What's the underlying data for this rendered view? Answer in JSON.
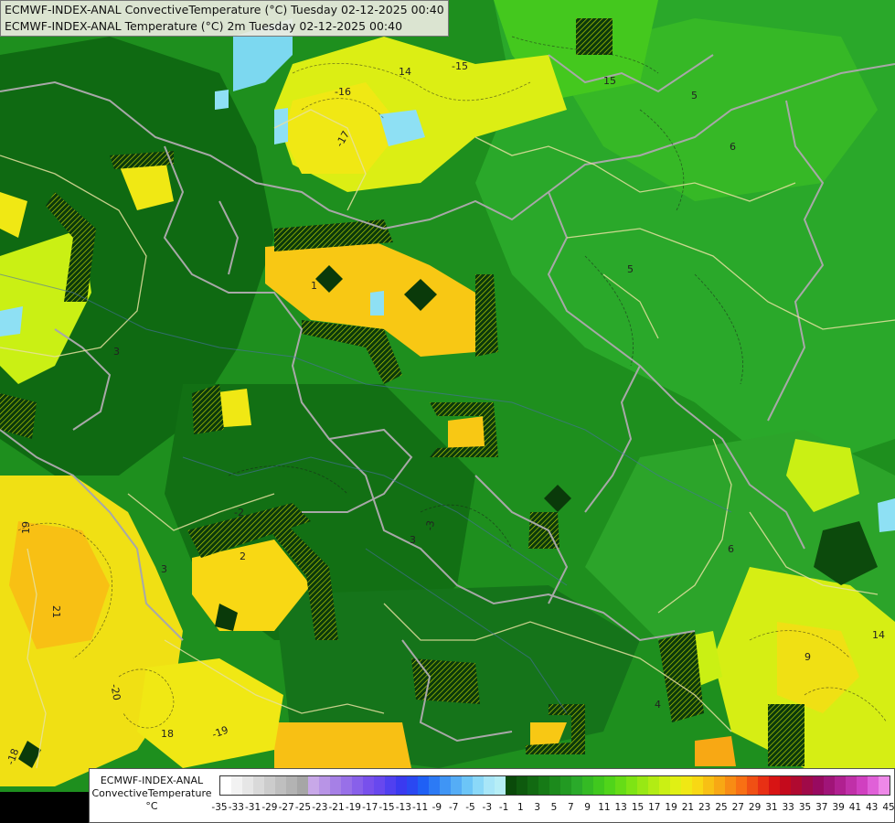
{
  "header": {
    "line1": "ECMWF-INDEX-ANAL ConvectiveTemperature (°C) Tuesday 02-12-2025 00:40",
    "line2": "ECMWF-INDEX-ANAL Temperature (°C) 2m Tuesday 02-12-2025 00:40"
  },
  "legend": {
    "title_line1": "ECMWF-INDEX-ANAL",
    "title_line2": "ConvectiveTemperature",
    "title_line3": "°C",
    "ticks": [
      "-35",
      "-33",
      "-31",
      "-29",
      "-27",
      "-25",
      "-23",
      "-21",
      "-19",
      "-17",
      "-15",
      "-13",
      "-11",
      "-9",
      "-7",
      "-5",
      "-3",
      "-1",
      "1",
      "3",
      "5",
      "7",
      "9",
      "11",
      "13",
      "15",
      "17",
      "19",
      "21",
      "23",
      "25",
      "27",
      "29",
      "31",
      "33",
      "35",
      "37",
      "39",
      "41",
      "43",
      "45"
    ],
    "colors": [
      "#ffffff",
      "#f2f2f2",
      "#e6e6e6",
      "#d9d9d9",
      "#cccccc",
      "#bfbfbf",
      "#b3b3b3",
      "#a6a6a6",
      "#c8a8e8",
      "#b894e6",
      "#a680e6",
      "#9870e8",
      "#8860ea",
      "#7850ec",
      "#6848ee",
      "#5040f0",
      "#3a3af0",
      "#2a48f2",
      "#1f60f5",
      "#2c7af5",
      "#3f95f5",
      "#55adf6",
      "#6cc5f7",
      "#8ad8f8",
      "#a8e6f8",
      "#b6eef6",
      "#0a4a0a",
      "#0e5a0e",
      "#126a12",
      "#167a16",
      "#1c8a1c",
      "#229a22",
      "#2aaa2a",
      "#34ba24",
      "#40c81e",
      "#50d41a",
      "#66dc16",
      "#7ee414",
      "#98e814",
      "#b2ec14",
      "#caf014",
      "#e0f014",
      "#f0e814",
      "#f8d814",
      "#f8c014",
      "#f8a814",
      "#f88c14",
      "#f87014",
      "#f05014",
      "#e83014",
      "#d81414",
      "#c40a1c",
      "#b00a30",
      "#a00a48",
      "#980a60",
      "#a01478",
      "#b02090",
      "#c030a8",
      "#d040c0",
      "#e060d8",
      "#ee88e8"
    ]
  },
  "map": {
    "isotherm_labels": [
      {
        "t": "-16"
      },
      {
        "t": "-17"
      },
      {
        "t": "14"
      },
      {
        "t": "15"
      },
      {
        "t": "-15"
      },
      {
        "t": "5"
      },
      {
        "t": "6"
      },
      {
        "t": "5"
      },
      {
        "t": "-2"
      },
      {
        "t": "2"
      },
      {
        "t": "3"
      },
      {
        "t": "-3"
      },
      {
        "t": "6"
      },
      {
        "t": "3"
      },
      {
        "t": "19"
      },
      {
        "t": "21"
      },
      {
        "t": "-20"
      },
      {
        "t": "18"
      },
      {
        "t": "-19"
      },
      {
        "t": "-18"
      },
      {
        "t": "14"
      },
      {
        "t": "9"
      },
      {
        "t": "4"
      },
      {
        "t": "1"
      },
      {
        "t": "3"
      }
    ]
  }
}
